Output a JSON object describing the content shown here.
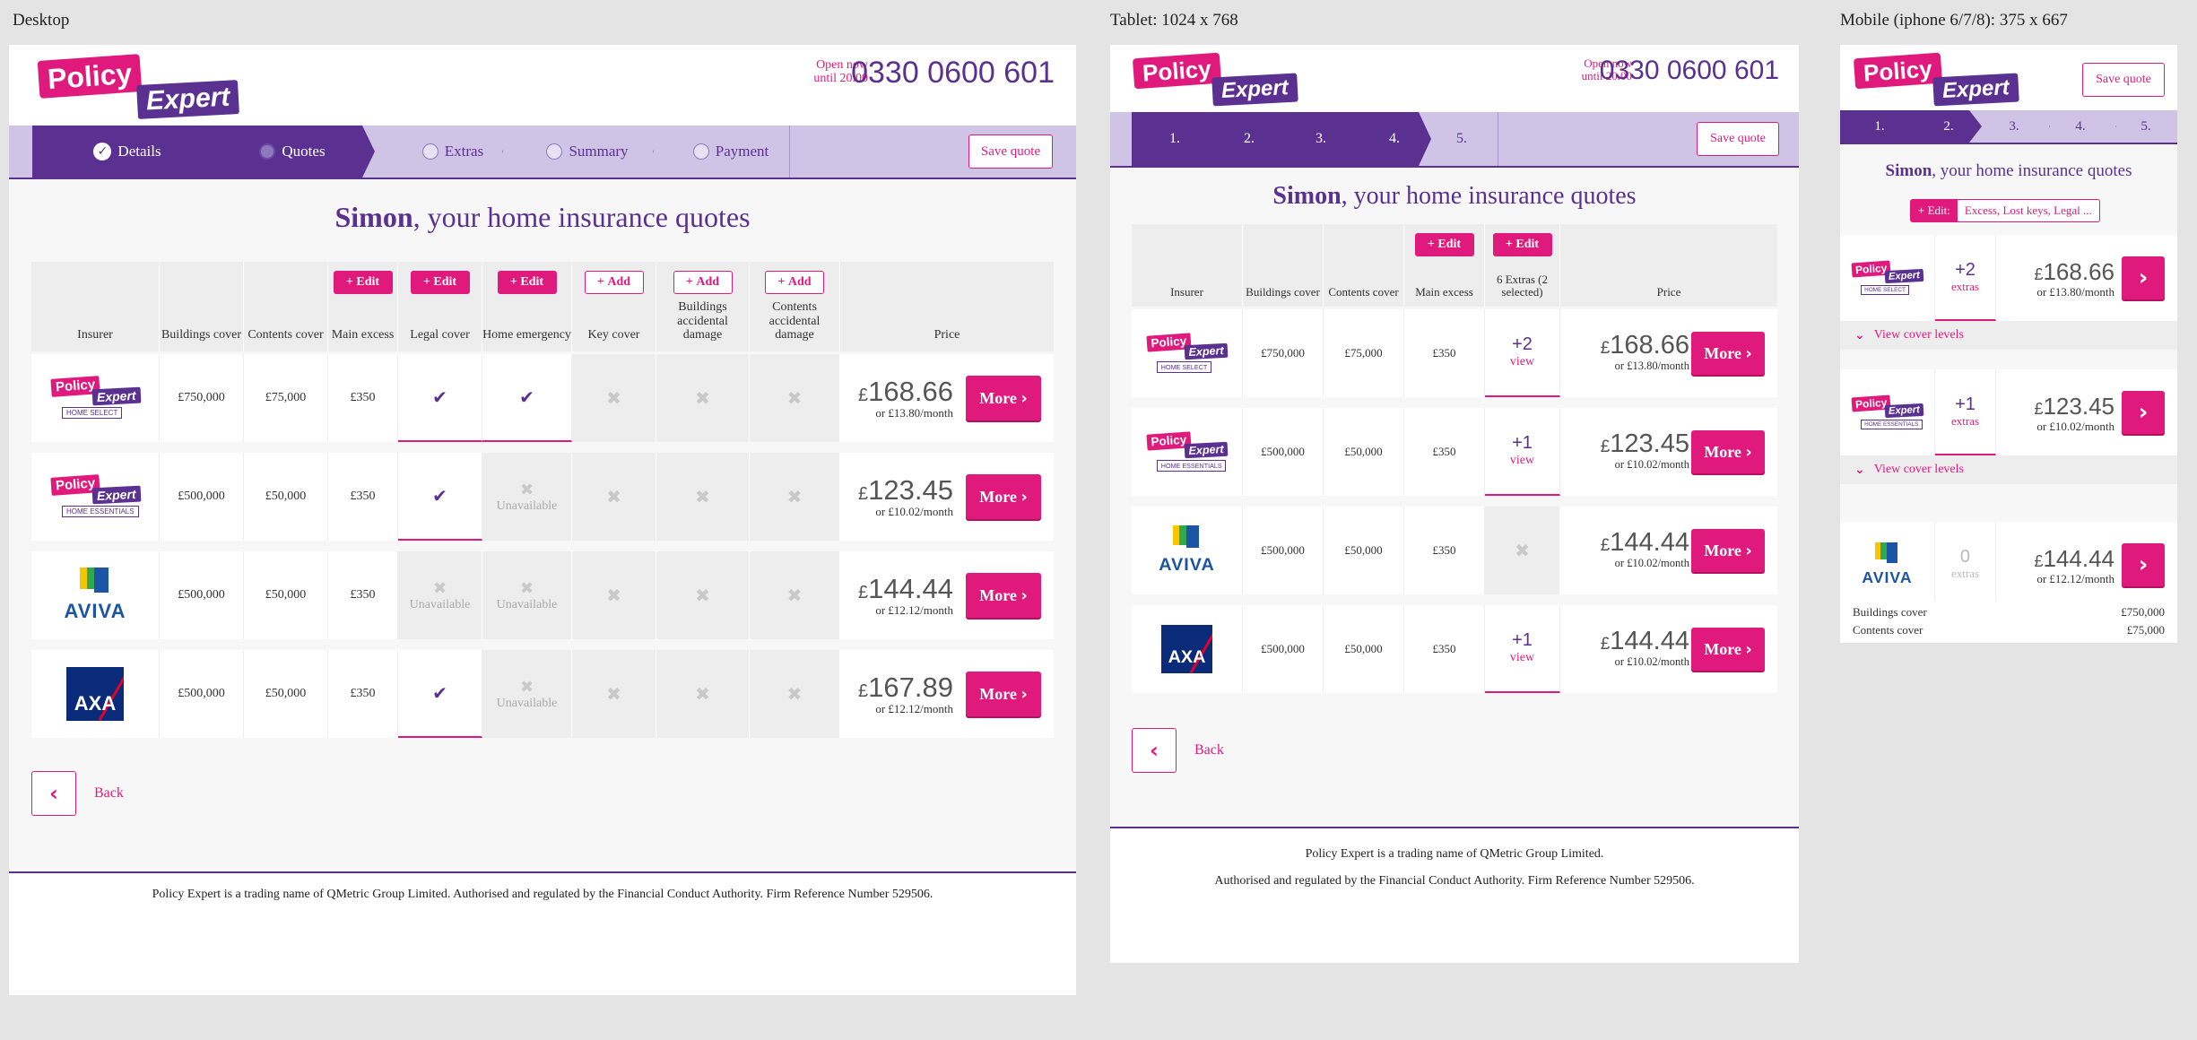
{
  "labels": {
    "desktop": "Desktop",
    "tablet": "Tablet: 1024 x 768",
    "mobile": "Mobile (iphone 6/7/8): 375 x 667"
  },
  "header": {
    "logo_top": "Policy",
    "logo_bottom": "Expert",
    "open_line1": "Open now",
    "open_line2": "until 20.00",
    "phone": "0330 0600 601",
    "save_quote": "Save quote"
  },
  "steps": {
    "desktop": [
      "Details",
      "Quotes",
      "Extras",
      "Summary",
      "Payment"
    ],
    "numbers": [
      "1.",
      "2.",
      "3.",
      "4.",
      "5."
    ]
  },
  "title": {
    "name": "Simon",
    "rest": ", your home insurance quotes"
  },
  "columns": {
    "insurer": "Insurer",
    "buildings": "Buildings cover",
    "contents": "Contents cover",
    "main_excess": "Main excess",
    "legal": "Legal cover",
    "home_emergency": "Home emergency",
    "key": "Key cover",
    "buildings_ad": "Buildings accidental damage",
    "contents_ad": "Contents accidental damage",
    "price": "Price",
    "extras_t": "6 Extras (2 selected)"
  },
  "buttons": {
    "edit": "Edit",
    "add": "Add",
    "more": "More",
    "back": "Back",
    "view": "view",
    "extras": "extras",
    "view_cover": "View cover levels",
    "unavailable": "Unavailable"
  },
  "mobile_edit": {
    "label": "Edit:",
    "value": "Excess, Lost keys, Legal ..."
  },
  "brand_badges": {
    "select": "HOME SELECT",
    "essentials": "HOME ESSENTIALS"
  },
  "aviva": "AVIVA",
  "axa": "AXA",
  "quotes": [
    {
      "buildings": "£750,000",
      "contents": "£75,000",
      "excess": "£350",
      "price_sym": "£",
      "price": "168.66",
      "monthly": "or £13.80/month",
      "extras": "+2",
      "tablet_price": "168.66",
      "tablet_monthly": "or £13.80/month"
    },
    {
      "buildings": "£500,000",
      "contents": "£50,000",
      "excess": "£350",
      "price_sym": "£",
      "price": "123.45",
      "monthly": "or £10.02/month",
      "extras": "+1",
      "tablet_price": "123.45",
      "tablet_monthly": "or £10.02/month"
    },
    {
      "buildings": "£500,000",
      "contents": "£50,000",
      "excess": "£350",
      "price_sym": "£",
      "price": "144.44",
      "monthly": "or £12.12/month",
      "extras": "0",
      "tablet_price": "144.44",
      "tablet_monthly": "or £10.02/month"
    },
    {
      "buildings": "£500,000",
      "contents": "£50,000",
      "excess": "£350",
      "price_sym": "£",
      "price": "167.89",
      "monthly": "or £12.12/month",
      "extras": "+1",
      "tablet_price": "144.44",
      "tablet_monthly": "or £10.02/month"
    }
  ],
  "mobile_summary": {
    "buildings_label": "Buildings cover",
    "buildings_value": "£750,000",
    "contents_label": "Contents cover",
    "contents_value": "£75,000"
  },
  "footer": {
    "desktop": "Policy Expert is a trading name of QMetric Group Limited. Authorised and regulated by the Financial Conduct Authority. Firm Reference Number 529506.",
    "tablet_line1": "Policy Expert is a trading name of QMetric Group Limited.",
    "tablet_line2": "Authorised and regulated by the Financial Conduct Authority. Firm Reference Number 529506."
  },
  "colors": {
    "pink": "#e0197d",
    "purple": "#5a3190",
    "lavender": "#d0c4e6"
  }
}
